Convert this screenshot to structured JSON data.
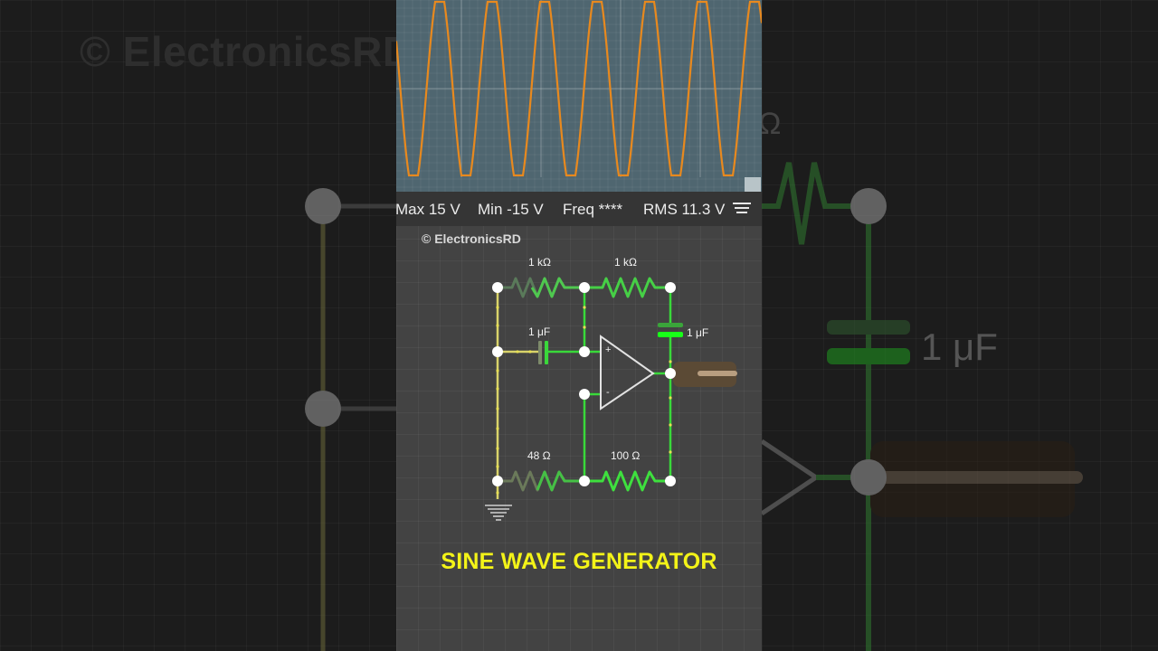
{
  "readout": {
    "max": "Max 15 V",
    "min": "Min -15 V",
    "freq": "Freq ****",
    "rms": "RMS 11.3 V"
  },
  "watermark": "© ElectronicsRD",
  "background": {
    "watermark": "© ElectronicsRD",
    "cap_label": "1 μF",
    "partial_unit": "Ω"
  },
  "components": {
    "r_top_left": "1 kΩ",
    "r_top_right": "1 kΩ",
    "c_left": "1 μF",
    "c_right": "1 μF",
    "r_bottom_left": "48 Ω",
    "r_bottom_right": "100 Ω",
    "opamp_plus": "+",
    "opamp_minus": "-"
  },
  "title": "SINE WAVE GENERATOR",
  "colors": {
    "wave": "#e8891e",
    "wire_active": "#39d93a",
    "wire_idle": "#d9d36a",
    "title": "#f3f318",
    "scope_bg": "#4f6670"
  },
  "icons": [
    "menu-icon",
    "ground-icon"
  ]
}
